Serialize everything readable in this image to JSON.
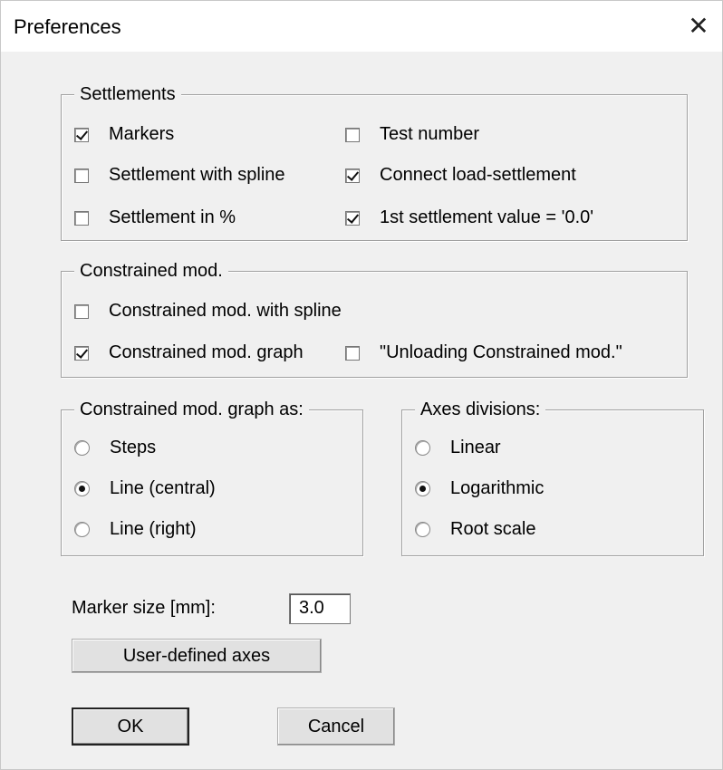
{
  "window": {
    "title": "Preferences",
    "close_icon": "close-icon"
  },
  "settlements": {
    "legend": "Settlements",
    "options": [
      {
        "label": "Markers",
        "checked": true
      },
      {
        "label": "Settlement with spline",
        "checked": false
      },
      {
        "label": "Settlement in %",
        "checked": false
      },
      {
        "label": "Test number",
        "checked": false
      },
      {
        "label": "Connect load-settlement",
        "checked": true
      },
      {
        "label": "1st settlement value = '0.0'",
        "checked": true
      }
    ]
  },
  "constrained": {
    "legend": "Constrained mod.",
    "options": [
      {
        "label": "Constrained mod. with spline",
        "checked": false
      },
      {
        "label": "Constrained mod. graph",
        "checked": true
      },
      {
        "label": "\"Unloading Constrained mod.\"",
        "checked": false
      }
    ]
  },
  "graph_as": {
    "legend": "Constrained mod. graph as:",
    "options": [
      "Steps",
      "Line (central)",
      "Line (right)"
    ],
    "selected": "Line (central)"
  },
  "axes": {
    "legend": "Axes divisions:",
    "options": [
      "Linear",
      "Logarithmic",
      "Root scale"
    ],
    "selected": "Logarithmic"
  },
  "marker_size": {
    "label": "Marker size [mm]:",
    "value": "3.0"
  },
  "buttons": {
    "user_axes": "User-defined axes",
    "ok": "OK",
    "cancel": "Cancel"
  }
}
